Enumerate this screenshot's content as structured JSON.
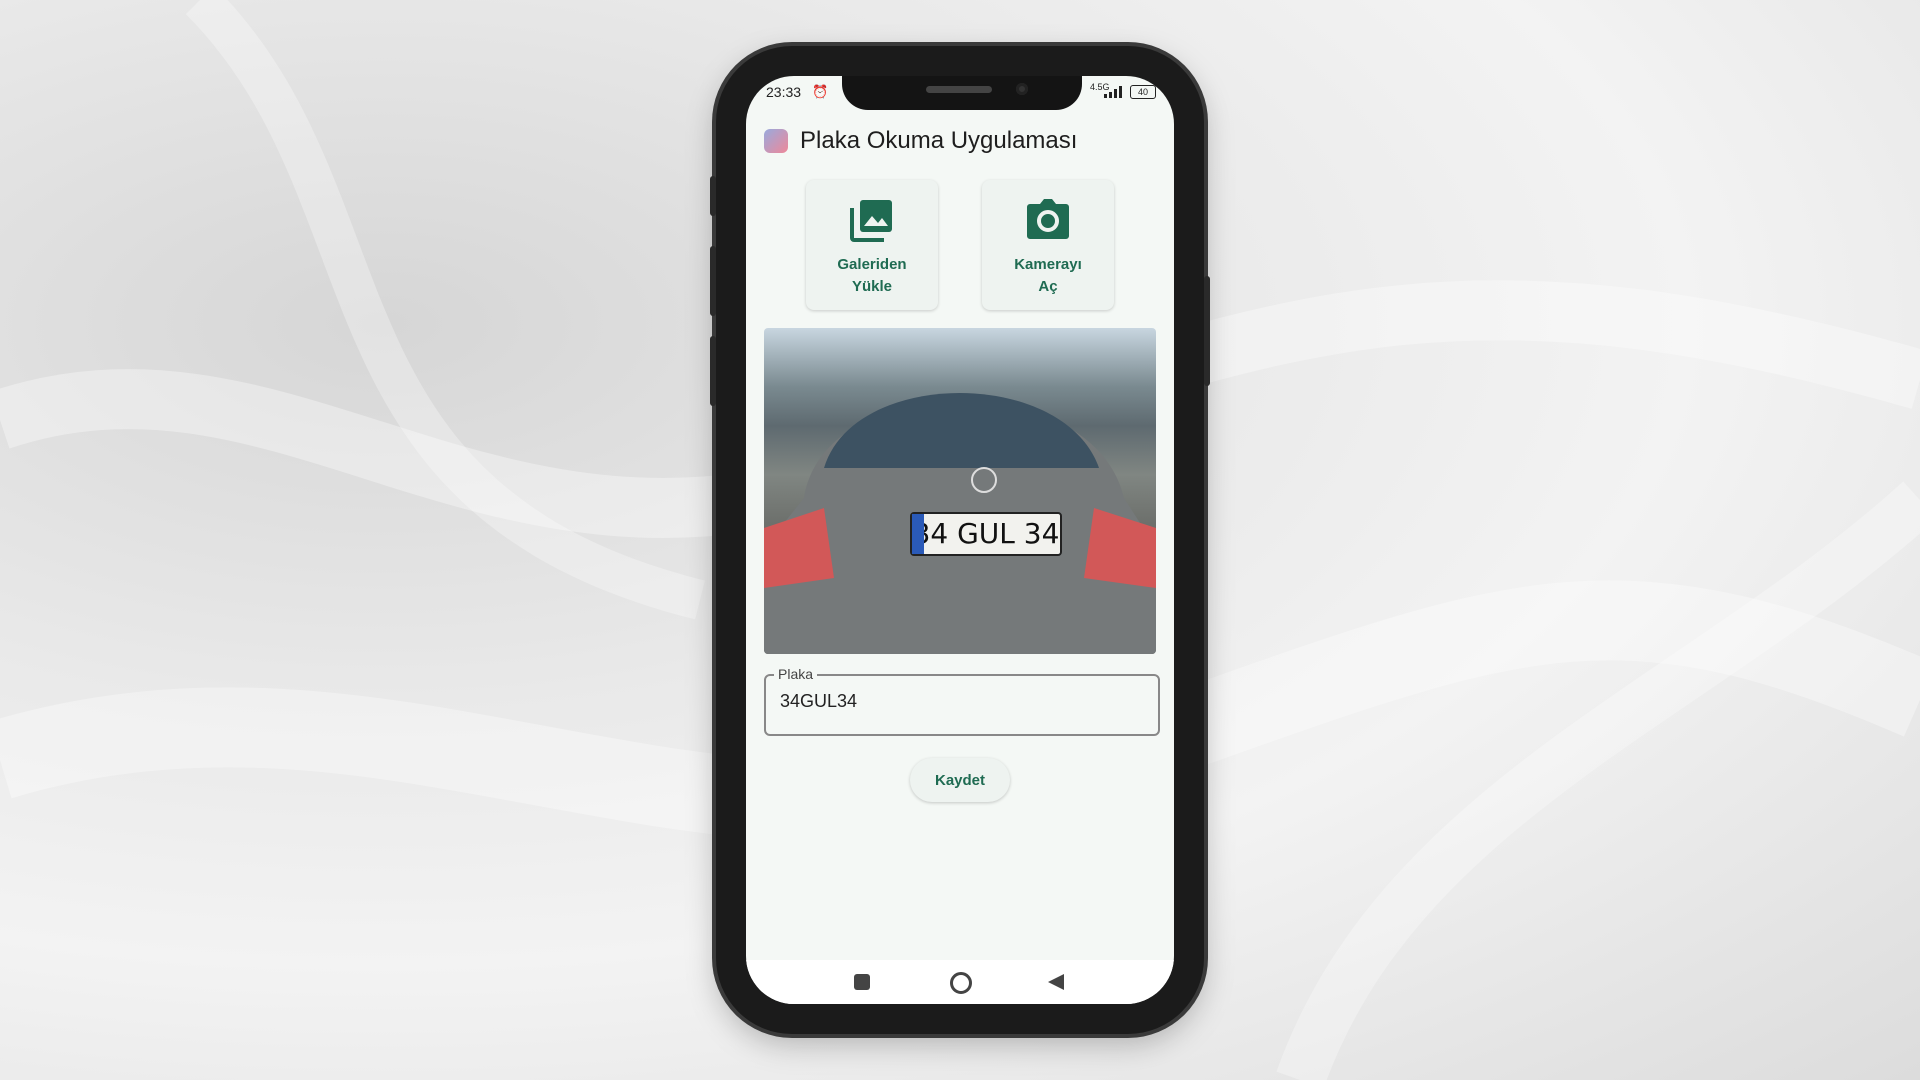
{
  "status_bar": {
    "time": "23:33",
    "network": "4.5G",
    "battery": "40"
  },
  "app": {
    "title": "Plaka Okuma Uygulaması"
  },
  "actions": [
    {
      "label_line1": "Galeriden",
      "label_line2": "Yükle",
      "icon": "gallery-icon"
    },
    {
      "label_line1": "Kamerayı",
      "label_line2": "Aç",
      "icon": "camera-icon"
    }
  ],
  "image": {
    "plate_text": "34 GUL 34"
  },
  "plate_field": {
    "label": "Plaka",
    "value": "34GUL34"
  },
  "save_button": {
    "label": "Kaydet"
  },
  "nav": {
    "recents": "square-icon",
    "home": "circle-icon",
    "back": "triangle-back-icon"
  },
  "colors": {
    "accent": "#1f6b52",
    "background": "#f4f8f5"
  }
}
